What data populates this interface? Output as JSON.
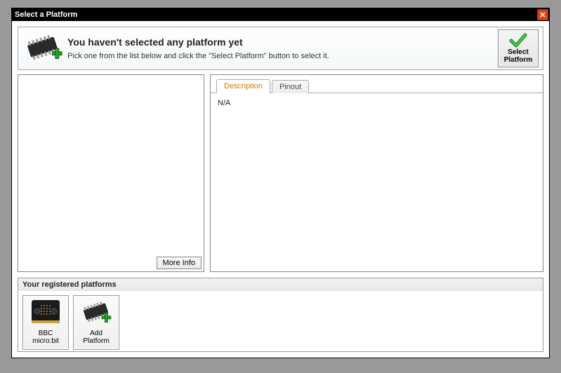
{
  "window": {
    "title": "Select a Platform"
  },
  "header": {
    "title": "You haven't selected any platform yet",
    "subtitle": "Pick one from the list below and click the \"Select Platform\" button to select it.",
    "select_button_line1": "Select",
    "select_button_line2": "Platform"
  },
  "list": {
    "more_info_label": "More Info"
  },
  "details": {
    "tabs": {
      "description": "Description",
      "pinout": "Pinout"
    },
    "active_tab": "description",
    "description_body": "N/A"
  },
  "registered": {
    "header": "Your registered platforms",
    "items": [
      {
        "id": "bbc-microbit",
        "label_line1": "BBC",
        "label_line2": "micro:bit"
      }
    ],
    "add_label_line1": "Add",
    "add_label_line2": "Platform"
  }
}
